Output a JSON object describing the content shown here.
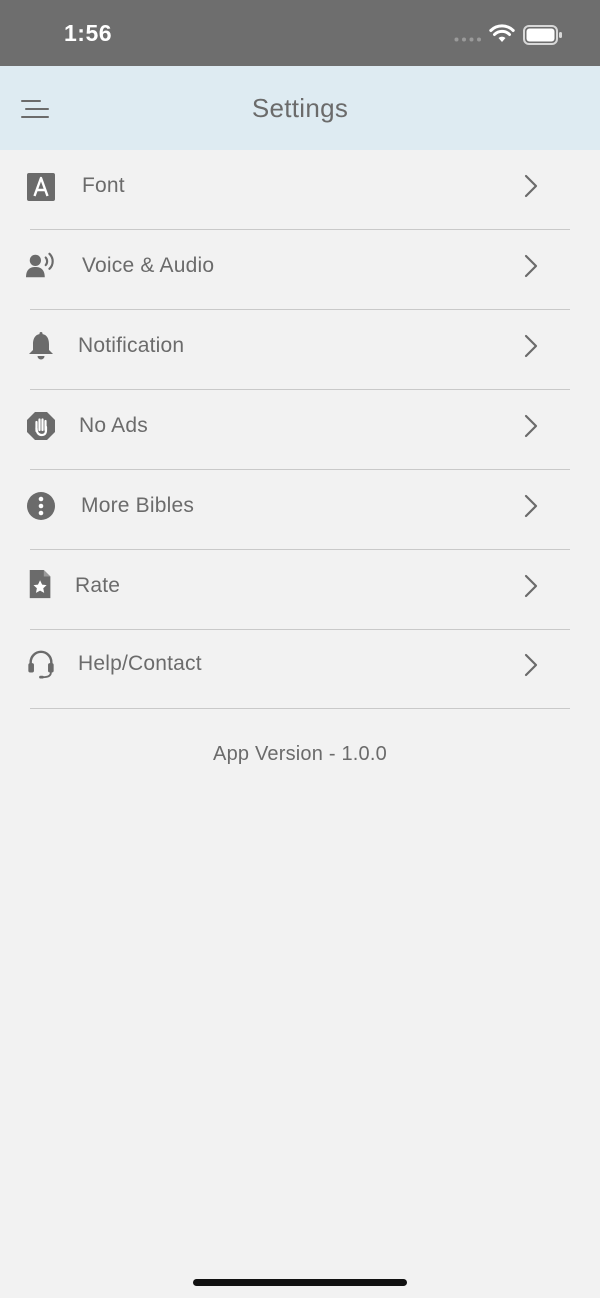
{
  "status_bar": {
    "time": "1:56"
  },
  "header": {
    "title": "Settings",
    "menu_icon": "menu-icon"
  },
  "settings": {
    "items": [
      {
        "label": "Font",
        "icon": "font-icon"
      },
      {
        "label": "Voice & Audio",
        "icon": "voice-audio-icon"
      },
      {
        "label": "Notification",
        "icon": "bell-icon"
      },
      {
        "label": "No Ads",
        "icon": "hand-stop-icon"
      },
      {
        "label": "More Bibles",
        "icon": "info-icon"
      },
      {
        "label": "Rate",
        "icon": "star-document-icon"
      },
      {
        "label": "Help/Contact",
        "icon": "headset-icon"
      }
    ]
  },
  "footer": {
    "app_version": "App Version - 1.0.0"
  },
  "colors": {
    "status_bar_bg": "#6e6e6e",
    "nav_bar_bg": "#deebf2",
    "page_bg": "#f2f2f2",
    "text": "#6b6b6b",
    "divider": "#c9c9c9"
  }
}
